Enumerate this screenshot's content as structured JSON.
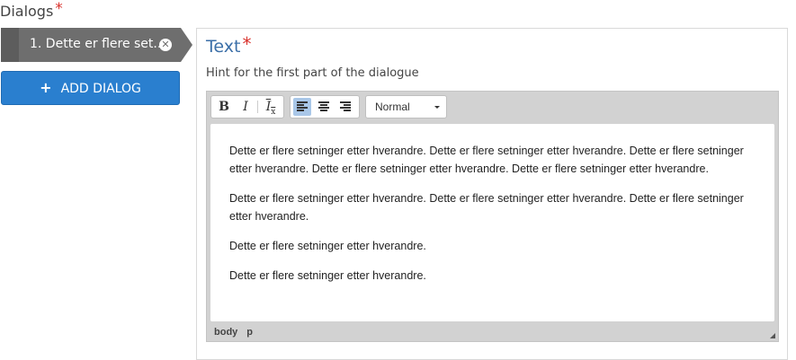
{
  "dialogs_label": "Dialogs",
  "required_mark": "*",
  "dialog_tabs": [
    {
      "label": "1. Dette er flere set...",
      "close_glyph": "✕"
    }
  ],
  "add_dialog": {
    "plus": "+",
    "label": "ADD DIALOG"
  },
  "text_field": {
    "title": "Text",
    "hint": "Hint for the first part of the dialogue"
  },
  "toolbar": {
    "bold": "B",
    "italic": "I",
    "remove_format": "I",
    "remove_format_sub": "x",
    "format_value": "Normal"
  },
  "editor_content": [
    "Dette er flere setninger etter hverandre. Dette er flere setninger etter hverandre. Dette er flere setninger etter hverandre. Dette er flere setninger etter hverandre. Dette er flere setninger etter hverandre.",
    "Dette er flere setninger etter hverandre. Dette er flere setninger etter hverandre. Dette er flere setninger etter hverandre.",
    "Dette er flere setninger etter hverandre.",
    "Dette er flere setninger etter hverandre."
  ],
  "element_path": [
    "body",
    "p"
  ],
  "colors": {
    "accent_button": "#2a7fcf",
    "title_blue": "#3b6fa8",
    "required_red": "#d9312b",
    "tab_gray": "#6e6e6e"
  }
}
